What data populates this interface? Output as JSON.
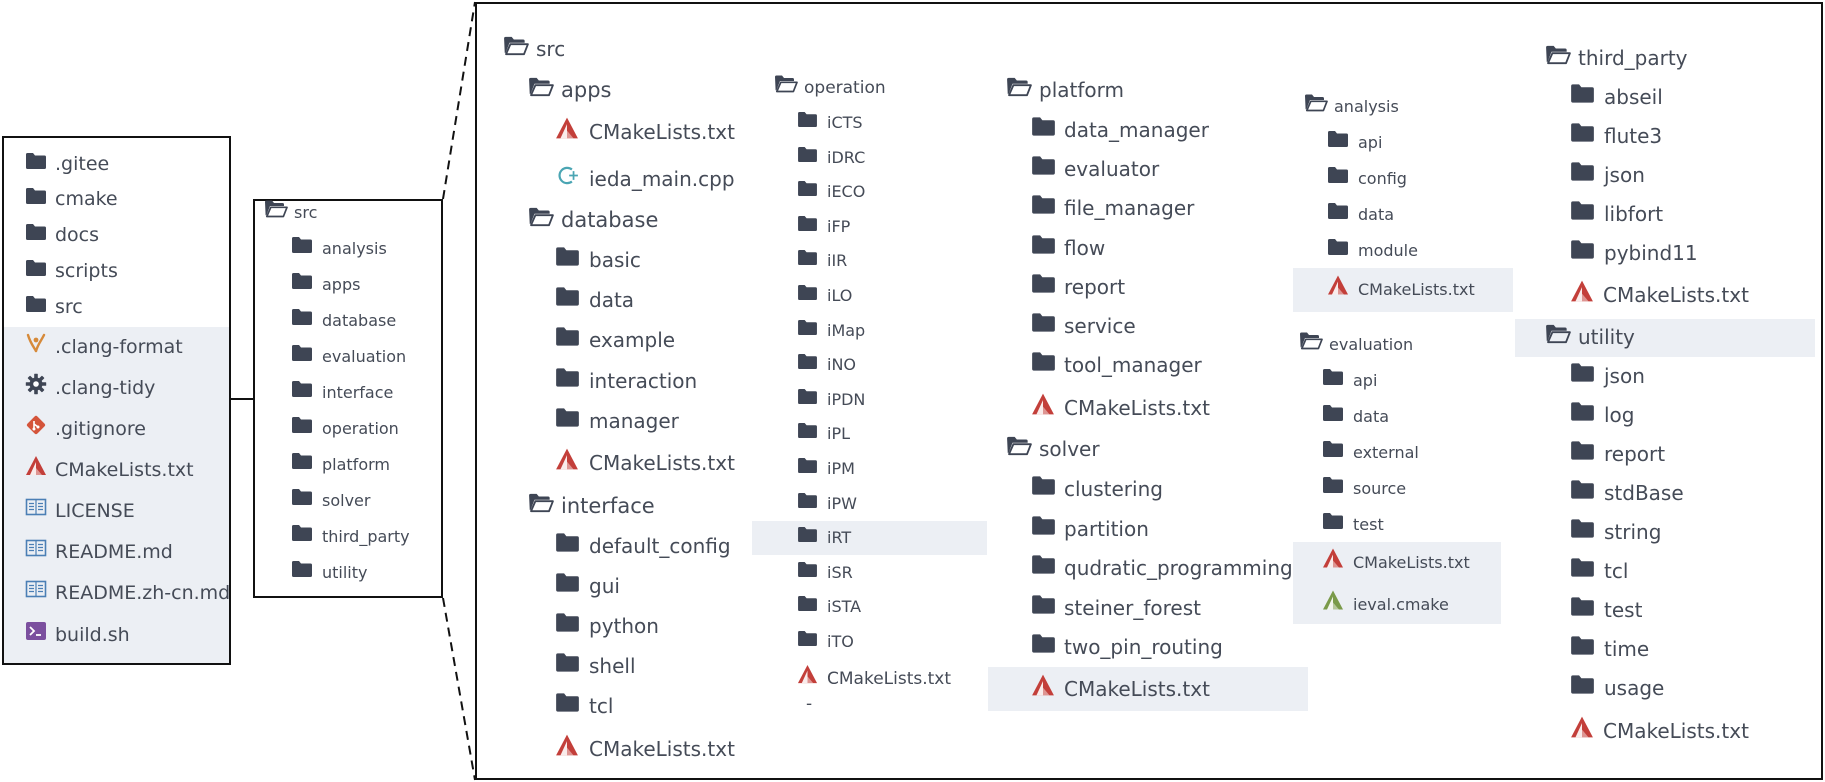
{
  "root": {
    "folders": [
      ".gitee",
      "cmake",
      "docs",
      "scripts",
      "src"
    ],
    "files": [
      {
        "name": ".clang-format",
        "icon": "clang-format-icon"
      },
      {
        "name": ".clang-tidy",
        "icon": "gear-icon"
      },
      {
        "name": ".gitignore",
        "icon": "git-icon"
      },
      {
        "name": "CMakeLists.txt",
        "icon": "cmake-icon"
      },
      {
        "name": "LICENSE",
        "icon": "document-icon"
      },
      {
        "name": "README.md",
        "icon": "document-icon"
      },
      {
        "name": "README.zh-cn.md",
        "icon": "document-icon"
      },
      {
        "name": "build.sh",
        "icon": "terminal-icon"
      }
    ]
  },
  "src_overview": {
    "title": "src",
    "children": [
      "analysis",
      "apps",
      "database",
      "evaluation",
      "interface",
      "operation",
      "platform",
      "solver",
      "third_party",
      "utility"
    ]
  },
  "detail": {
    "src_title": "src",
    "apps": {
      "title": "apps",
      "files": [
        "CMakeLists.txt",
        "ieda_main.cpp"
      ]
    },
    "database": {
      "title": "database",
      "folders": [
        "basic",
        "data",
        "example",
        "interaction",
        "manager"
      ],
      "file": "CMakeLists.txt"
    },
    "interface": {
      "title": "interface",
      "folders": [
        "default_config",
        "gui",
        "python",
        "shell",
        "tcl"
      ],
      "file": "CMakeLists.txt"
    },
    "operation": {
      "title": "operation",
      "folders": [
        "iCTS",
        "iDRC",
        "iECO",
        "iFP",
        "iIR",
        "iLO",
        "iMap",
        "iNO",
        "iPDN",
        "iPL",
        "iPM",
        "iPW",
        "iRT",
        "iSR",
        "iSTA",
        "iTO"
      ],
      "file": "CMakeLists.txt",
      "trailing": "-"
    },
    "platform": {
      "title": "platform",
      "folders": [
        "data_manager",
        "evaluator",
        "file_manager",
        "flow",
        "report",
        "service",
        "tool_manager"
      ],
      "file": "CMakeLists.txt"
    },
    "solver": {
      "title": "solver",
      "folders": [
        "clustering",
        "partition",
        "qudratic_programming",
        "steiner_forest",
        "two_pin_routing"
      ],
      "file": "CMakeLists.txt"
    },
    "analysis": {
      "title": "analysis",
      "folders": [
        "api",
        "config",
        "data",
        "module"
      ],
      "file": "CMakeLists.txt"
    },
    "evaluation": {
      "title": "evaluation",
      "folders": [
        "api",
        "data",
        "external",
        "source",
        "test"
      ],
      "files": [
        "CMakeLists.txt",
        "ieval.cmake"
      ]
    },
    "third_party": {
      "title": "third_party",
      "folders": [
        "abseil",
        "flute3",
        "json",
        "libfort",
        "pybind11"
      ],
      "file": "CMakeLists.txt"
    },
    "utility": {
      "title": "utility",
      "folders": [
        "json",
        "log",
        "report",
        "stdBase",
        "string",
        "tcl",
        "test",
        "time",
        "usage"
      ],
      "file": "CMakeLists.txt"
    }
  },
  "colors": {
    "folder": "#3e4554",
    "cmake_red": "#c33f3a",
    "cmake_green": "#7a9a4a",
    "cpp": "#4aa5b3",
    "document": "#4b7fb5",
    "terminal": "#7b4f9e",
    "git": "#d4543a",
    "clang_format": "#d68a3a",
    "highlight": "#eceff4",
    "text": "#454b57"
  }
}
